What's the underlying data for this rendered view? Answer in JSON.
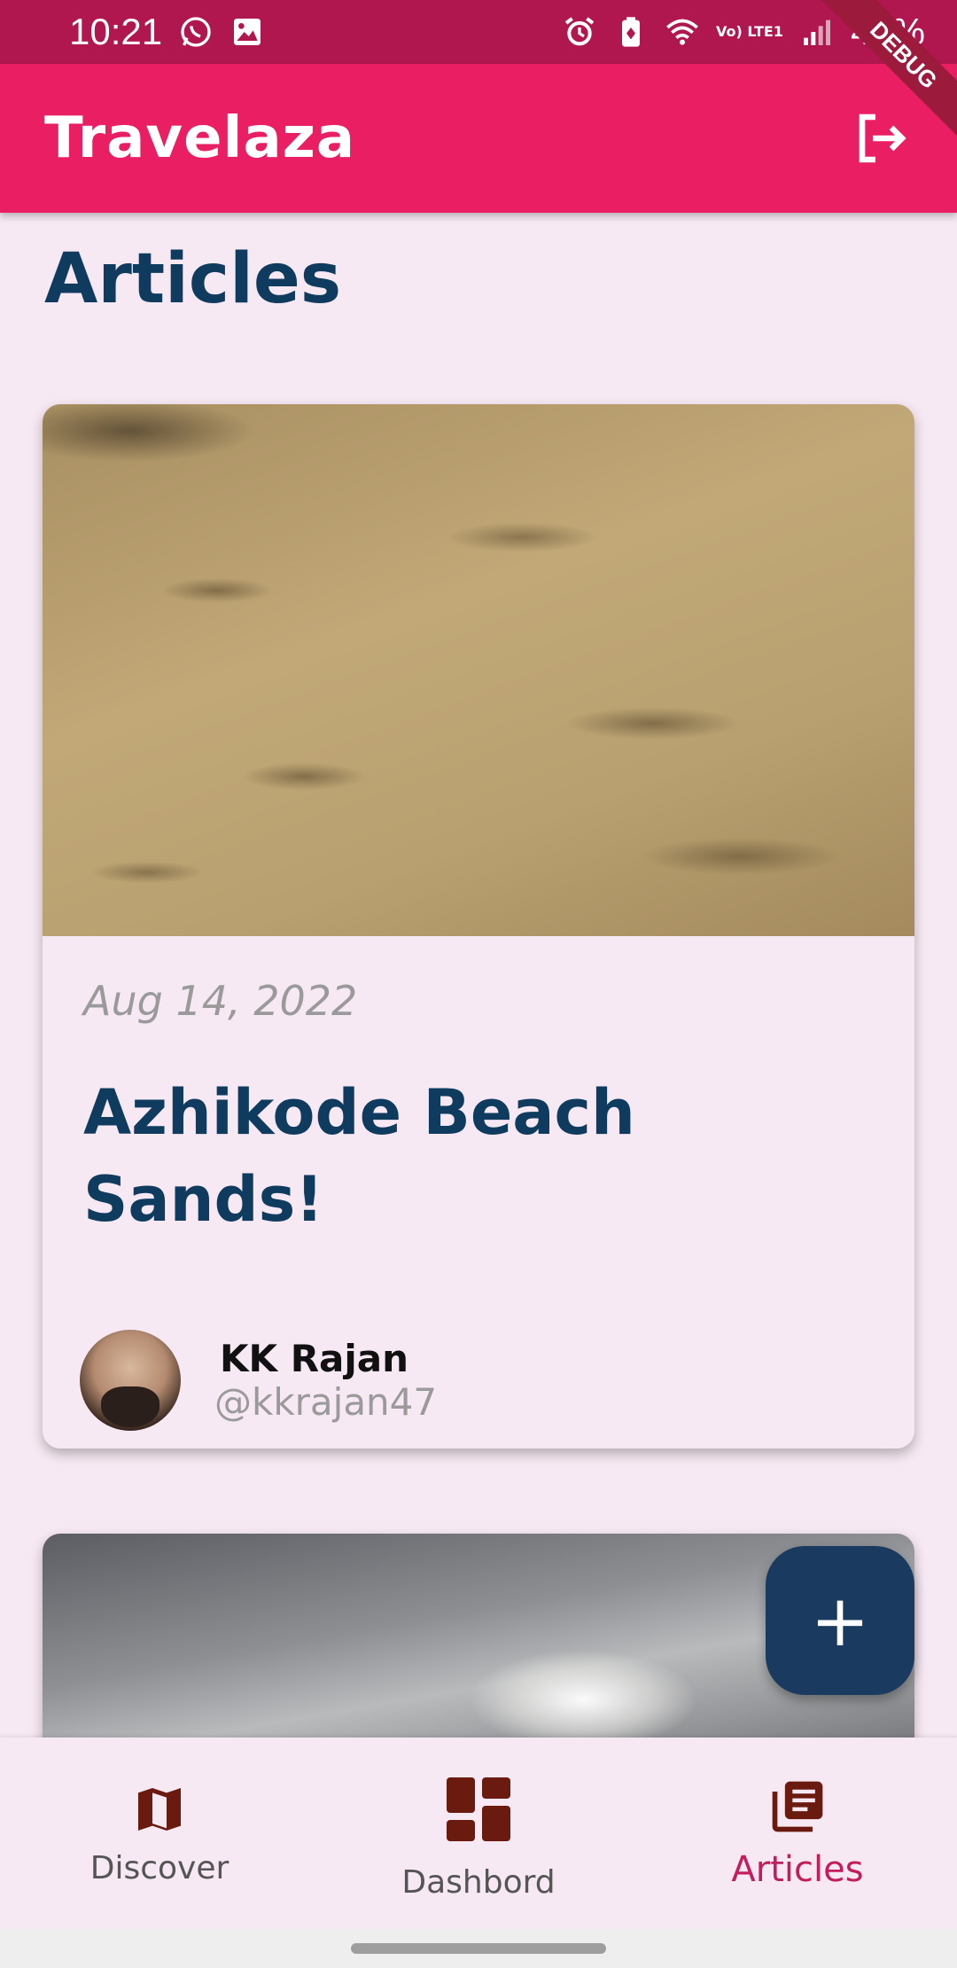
{
  "status_bar": {
    "time": "10:21",
    "network_label": "Vo) LTE1",
    "battery": "48%"
  },
  "app_bar": {
    "title": "Travelaza",
    "debug_label": "DEBUG"
  },
  "page": {
    "title": "Articles"
  },
  "articles": [
    {
      "date": "Aug 14, 2022",
      "title": "Azhikode Beach Sands!",
      "author_name": "KK Rajan",
      "author_handle": "@kkrajan47"
    }
  ],
  "fab": {
    "icon": "plus-icon",
    "label": "+"
  },
  "bottom_nav": {
    "items": [
      {
        "label": "Discover",
        "icon": "map-icon"
      },
      {
        "label": "Dashbord",
        "icon": "dashboard-icon"
      },
      {
        "label": "Articles",
        "icon": "articles-icon",
        "active": true
      }
    ]
  },
  "colors": {
    "status_bar": "#b0174f",
    "app_bar": "#ea1e63",
    "title_text": "#0f3b5f",
    "fab": "#1a3a5f",
    "nav_icon": "#6b1a10",
    "nav_active": "#c21d5c"
  }
}
